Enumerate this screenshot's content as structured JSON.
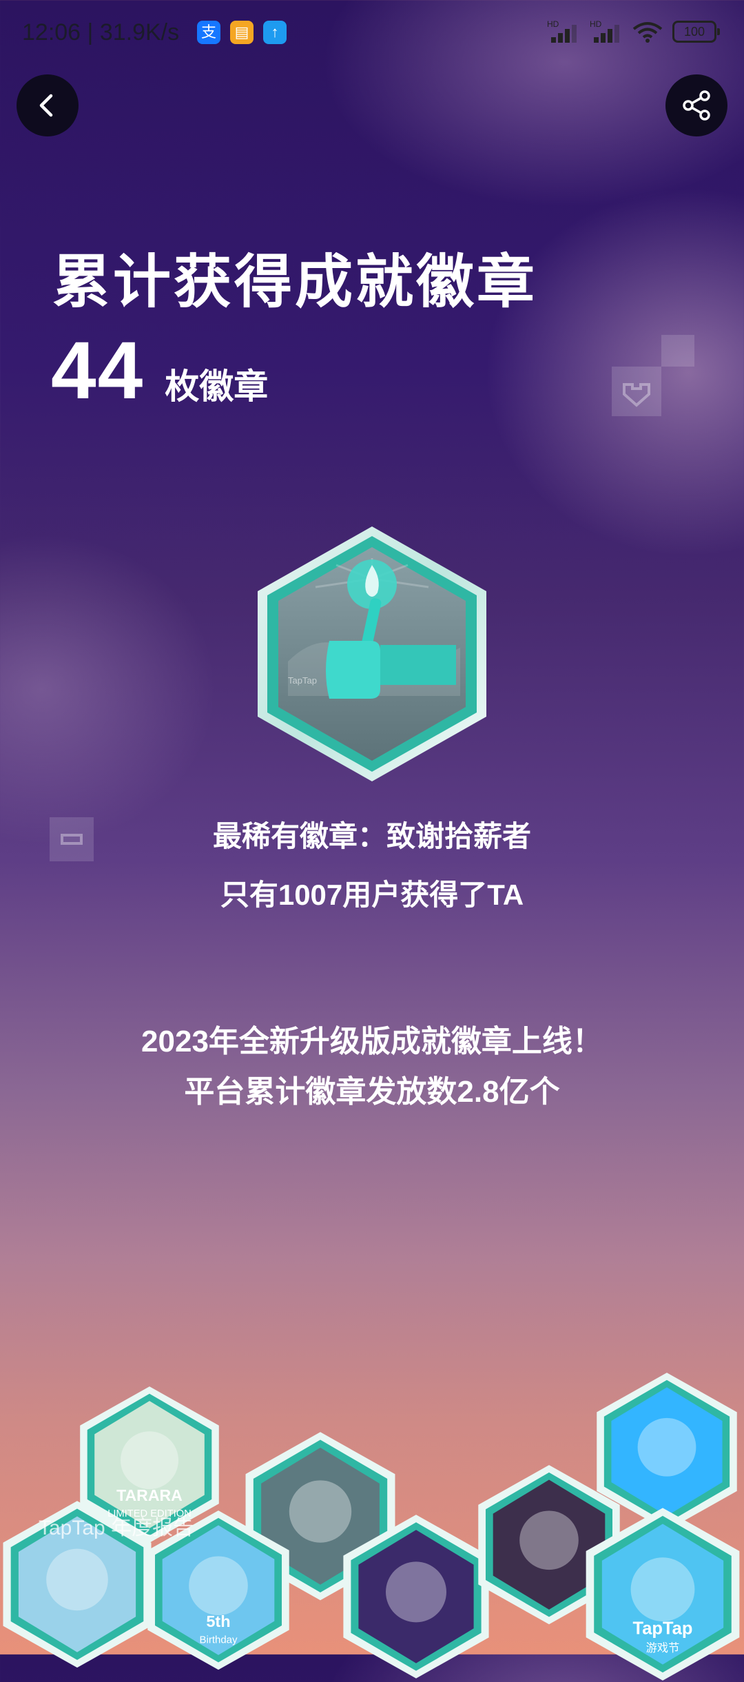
{
  "status_bar": {
    "time": "12:06",
    "speed": "31.9K/s",
    "battery": "100",
    "app_icons": [
      "alipay-icon",
      "notes-icon",
      "upload-icon"
    ],
    "app_colors": [
      "#1677ff",
      "#f5a623",
      "#1e9bf0"
    ],
    "network_labels": [
      "HD",
      "HD"
    ]
  },
  "nav": {
    "back_icon": "chevron-left-icon",
    "share_icon": "share-icon"
  },
  "header": {
    "title": "累计获得成就徽章",
    "count": "44",
    "count_unit": "枚徽章"
  },
  "featured_badge": {
    "logo_text": "TapTap",
    "icon": "torch-hand-icon",
    "colors": {
      "frame": "#2fb7a4",
      "inner": "#78898f",
      "flame": "#3fe1d4"
    }
  },
  "rare": {
    "line1": "最稀有徽章：致谢拾薪者",
    "line2": "只有1007用户获得了TA"
  },
  "notice": {
    "line1": "2023年全新升级版成就徽章上线！",
    "line2": "平台累计徽章发放数2.8亿个"
  },
  "badge_wall": [
    {
      "name": "tarara-badge",
      "label": "TARARA",
      "sub": "LIMITED EDITION",
      "color": "#cfe7d6"
    },
    {
      "name": "campfire-badge",
      "label": "",
      "sub": "",
      "color": "#5d7a80"
    },
    {
      "name": "astronaut-badge",
      "label": "",
      "sub": "",
      "color": "#33b5ff"
    },
    {
      "name": "pink-girl-badge",
      "label": "",
      "sub": "",
      "color": "#9ad2ea"
    },
    {
      "name": "birthday-badge",
      "label": "5th",
      "sub": "Birthday",
      "color": "#6ec6ef"
    },
    {
      "name": "hooded-badge",
      "label": "",
      "sub": "",
      "color": "#3b2a6a"
    },
    {
      "name": "robot-badge",
      "label": "",
      "sub": "",
      "color": "#3d2f4c"
    },
    {
      "name": "festival-badge",
      "label": "TapTap",
      "sub": "游戏节",
      "color": "#4fc4f2"
    }
  ],
  "watermark": "TapTap 年度报告"
}
